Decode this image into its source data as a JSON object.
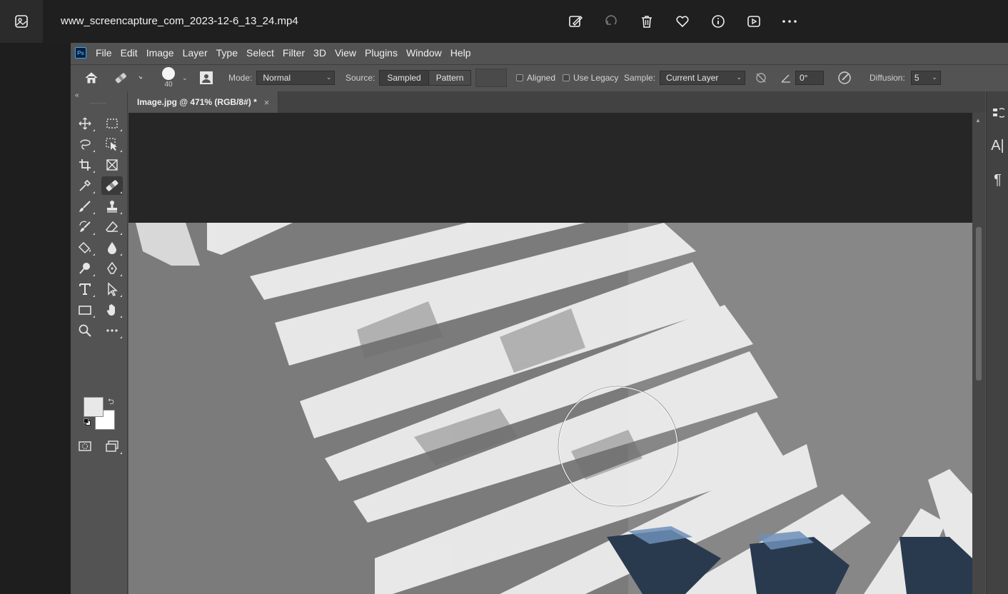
{
  "viewer": {
    "title": "www_screencapture_com_2023-12-6_13_24.mp4",
    "actions": [
      "edit-image-icon",
      "rotate-icon",
      "delete-icon",
      "favorite-icon",
      "info-icon",
      "slideshow-icon",
      "more-icon"
    ]
  },
  "photoshop": {
    "logo_text": "Ps",
    "menu": [
      "File",
      "Edit",
      "Image",
      "Layer",
      "Type",
      "Select",
      "Filter",
      "3D",
      "View",
      "Plugins",
      "Window",
      "Help"
    ],
    "options": {
      "brush_size": "40",
      "mode_label": "Mode:",
      "mode_value": "Normal",
      "source_label": "Source:",
      "source_sampled": "Sampled",
      "source_pattern": "Pattern",
      "aligned_label": "Aligned",
      "use_legacy_label": "Use Legacy",
      "sample_label": "Sample:",
      "sample_value": "Current Layer",
      "angle_value": "0°",
      "diffusion_label": "Diffusion:",
      "diffusion_value": "5"
    },
    "document_tab": {
      "title": "Image.jpg @ 471% (RGB/8#) *",
      "close": "×"
    },
    "tools": [
      "move-tool-icon",
      "marquee-tool-icon",
      "lasso-tool-icon",
      "object-select-tool-icon",
      "crop-tool-icon",
      "frame-tool-icon",
      "eyedropper-tool-icon",
      "healing-brush-tool-icon",
      "brush-tool-icon",
      "clone-stamp-tool-icon",
      "history-brush-tool-icon",
      "eraser-tool-icon",
      "paint-bucket-tool-icon",
      "blur-tool-icon",
      "dodge-tool-icon",
      "pen-tool-icon",
      "type-tool-icon",
      "path-select-tool-icon",
      "rectangle-tool-icon",
      "hand-tool-icon",
      "zoom-tool-icon",
      "more-tools-icon"
    ],
    "colors": {
      "foreground": "#e8e8e8",
      "background": "#ffffff",
      "accent": "#31a8ff"
    },
    "right_dock": {
      "paragraph_glyph": "¶",
      "character_glyph": "A|"
    }
  }
}
